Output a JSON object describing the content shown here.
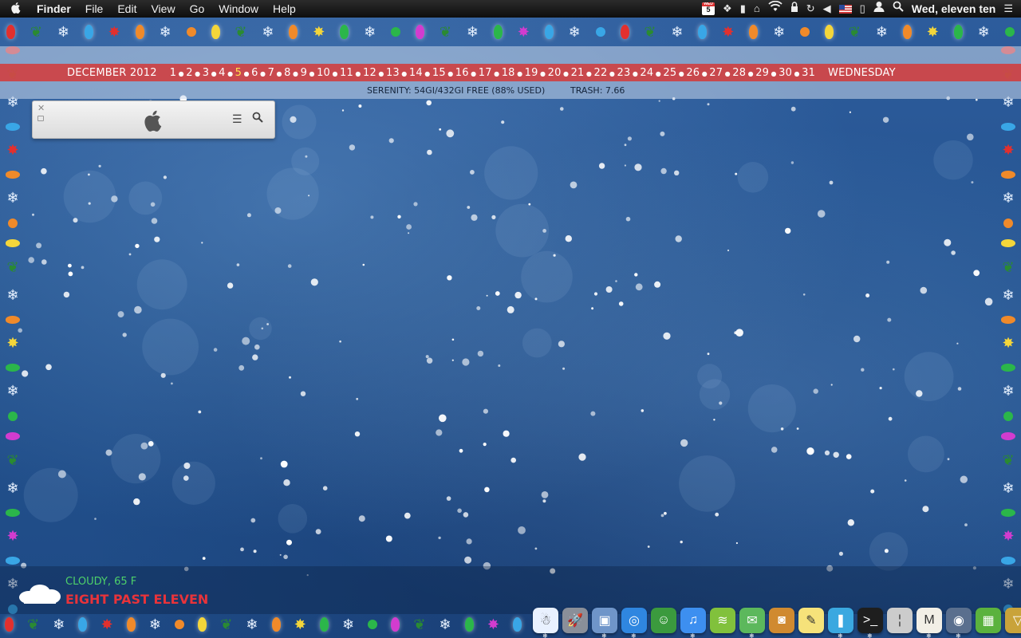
{
  "menubar": {
    "app_name": "Finder",
    "menus": [
      "File",
      "Edit",
      "View",
      "Go",
      "Window",
      "Help"
    ],
    "calendar_icon_day": "5",
    "calendar_icon_month": "WED",
    "clock": "Wed, eleven ten"
  },
  "calendar_bar": {
    "month_year": "DECEMBER 2012",
    "days": [
      "1",
      "2",
      "3",
      "4",
      "5",
      "6",
      "7",
      "8",
      "9",
      "10",
      "11",
      "12",
      "13",
      "14",
      "15",
      "16",
      "17",
      "18",
      "19",
      "20",
      "21",
      "22",
      "23",
      "24",
      "25",
      "26",
      "27",
      "28",
      "29",
      "30",
      "31"
    ],
    "today": "5",
    "weekday": "WEDNESDAY",
    "today_color": "#ffe24a",
    "bar_color": "#d64646"
  },
  "info_bar": {
    "disk": "SERENITY: 54GI/432GI FREE (88% USED)",
    "trash": "TRASH: 7.66"
  },
  "finder_widget": {
    "logo": "apple-logo",
    "list_icon": "list-icon",
    "search_icon": "search-icon"
  },
  "weather": {
    "condition": "CLOUDY, 65 F",
    "time_text": "EIGHT PAST ELEVEN",
    "condition_color": "#4ed16a",
    "time_color": "#e8333a"
  },
  "dock": {
    "apps": [
      {
        "name": "snowman-icon",
        "color": "#e9f1ff",
        "glyph": "☃",
        "running": true
      },
      {
        "name": "launchpad-icon",
        "color": "#8a8f99",
        "glyph": "🚀",
        "running": false
      },
      {
        "name": "preview-icon",
        "color": "#6f95c9",
        "glyph": "▣",
        "running": true
      },
      {
        "name": "safari-icon",
        "color": "#2f86e0",
        "glyph": "◎",
        "running": true
      },
      {
        "name": "adium-icon",
        "color": "#3b9a3e",
        "glyph": "☺",
        "running": false
      },
      {
        "name": "itunes-icon",
        "color": "#3d8ff0",
        "glyph": "♫",
        "running": true
      },
      {
        "name": "spotify-icon",
        "color": "#81c13c",
        "glyph": "≋",
        "running": false
      },
      {
        "name": "messages-icon",
        "color": "#5cb85c",
        "glyph": "✉",
        "running": true
      },
      {
        "name": "iphoto-icon",
        "color": "#d08a30",
        "glyph": "◙",
        "running": false
      },
      {
        "name": "notes-icon",
        "color": "#f6e27a",
        "glyph": "✎",
        "running": false
      },
      {
        "name": "bulb-icon",
        "color": "#3aa8e0",
        "glyph": "❚",
        "running": true
      },
      {
        "name": "terminal-icon",
        "color": "#1e1e1e",
        "glyph": ">_",
        "running": true
      },
      {
        "name": "candle-icon",
        "color": "#cccccc",
        "glyph": "¦",
        "running": false
      },
      {
        "name": "mail-icon",
        "color": "#f2efe6",
        "glyph": "M",
        "running": true
      },
      {
        "name": "time-machine-icon",
        "color": "#5a6f8e",
        "glyph": "◉",
        "running": true
      },
      {
        "name": "gift-icon",
        "color": "#5bb23e",
        "glyph": "▦",
        "running": false
      },
      {
        "name": "trash-icon",
        "color": "#c9a33a",
        "glyph": "▽",
        "running": false
      }
    ]
  }
}
